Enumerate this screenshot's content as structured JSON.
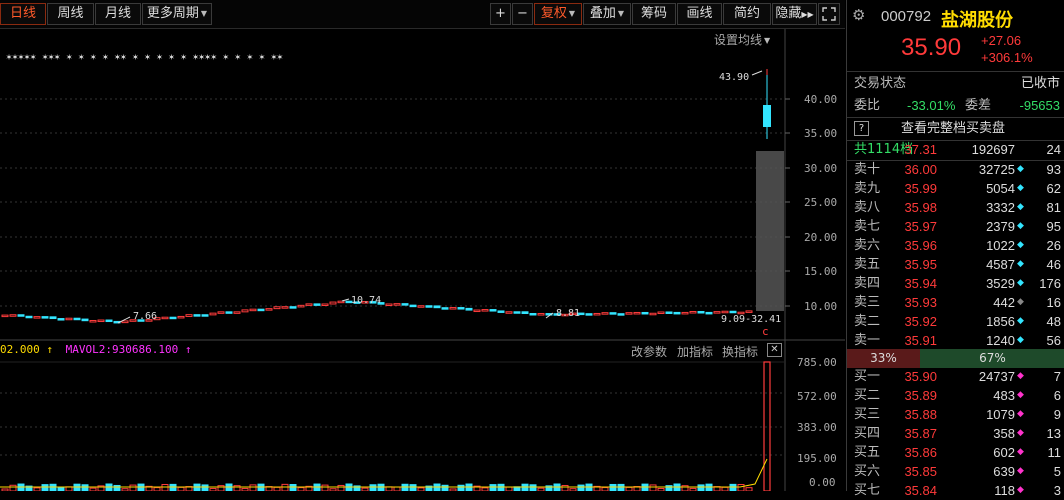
{
  "toolbar": {
    "tabs": [
      "日线",
      "周线",
      "月线",
      "更多周期"
    ],
    "plus": "+",
    "minus": "−",
    "fuquan": "复权",
    "diejia": "叠加",
    "chouma": "筹码",
    "huaxian": "画线",
    "jianyue": "简约",
    "yincang": "隐藏",
    "expand_icon": "expand-icon",
    "more_icon": "double-arrow-right-icon"
  },
  "chart": {
    "set_ma_label": "设置均线",
    "star_marks": "✶✶✶✶✶   ✶✶✶   ✶     ✶      ✶   ✶    ✶✶      ✶   ✶              ✶               ✶     ✶       ✶✶✶✶   ✶   ✶      ✶   ✶      ✶✶",
    "price_axis": [
      "40.00",
      "35.00",
      "30.00",
      "25.00",
      "20.00",
      "15.00",
      "10.00"
    ],
    "high_label": "43.90",
    "low_label": "7.66",
    "peak_label": "10.74",
    "mid_label": "8.81",
    "end_label": "9.09-32.41",
    "signal_icon": "c-signal-icon",
    "volume_axis": [
      "785.00",
      "572.00",
      "383.00",
      "195.00",
      "0.00"
    ],
    "vol_legend_1": "02.000",
    "vol_legend_2": "MAVOL2:930686.100",
    "ind_btn_1": "改参数",
    "ind_btn_2": "加指标",
    "ind_btn_3": "换指标",
    "close_icon": "close-icon",
    "colors": {
      "up": "#ff3c3c",
      "down": "#33e5ff",
      "ma": "#ffffff",
      "mavol": "#ff33ff"
    }
  },
  "panel": {
    "code": "000792",
    "name": "盐湖股份",
    "price": "35.90",
    "change": "+27.06",
    "change_pct": "+306.1%",
    "trade_status_label": "交易状态",
    "trade_status_value": "已收市",
    "weibi_label": "委比",
    "weibi_value": "-33.01%",
    "weicha_label": "委差",
    "weicha_value": "-95653",
    "help_icon": "help-icon",
    "full_book_label": "查看完整档买卖盘",
    "total_label": "共1114档",
    "total_price": "37.31",
    "total_vol": "192697",
    "total_cnt": "24",
    "ratio_left": "33%",
    "ratio_right": "67%",
    "asks": [
      {
        "label": "卖十",
        "price": "36.00",
        "vol": "32725",
        "cnt": "93",
        "dot": "#33e5ff"
      },
      {
        "label": "卖九",
        "price": "35.99",
        "vol": "5054",
        "cnt": "62",
        "dot": "#33e5ff"
      },
      {
        "label": "卖八",
        "price": "35.98",
        "vol": "3332",
        "cnt": "81",
        "dot": "#33e5ff"
      },
      {
        "label": "卖七",
        "price": "35.97",
        "vol": "2379",
        "cnt": "95",
        "dot": "#33e5ff"
      },
      {
        "label": "卖六",
        "price": "35.96",
        "vol": "1022",
        "cnt": "26",
        "dot": "#33e5ff"
      },
      {
        "label": "卖五",
        "price": "35.95",
        "vol": "4587",
        "cnt": "46",
        "dot": "#33e5ff"
      },
      {
        "label": "卖四",
        "price": "35.94",
        "vol": "3529",
        "cnt": "176",
        "dot": "#33e5ff"
      },
      {
        "label": "卖三",
        "price": "35.93",
        "vol": "442",
        "cnt": "16",
        "dot": "#888888"
      },
      {
        "label": "卖二",
        "price": "35.92",
        "vol": "1856",
        "cnt": "48",
        "dot": "#33e5ff"
      },
      {
        "label": "卖一",
        "price": "35.91",
        "vol": "1240",
        "cnt": "56",
        "dot": "#33e5ff"
      }
    ],
    "bids": [
      {
        "label": "买一",
        "price": "35.90",
        "vol": "24737",
        "cnt": "7",
        "dot": "#ff33cc"
      },
      {
        "label": "买二",
        "price": "35.89",
        "vol": "483",
        "cnt": "6",
        "dot": "#ff33cc"
      },
      {
        "label": "买三",
        "price": "35.88",
        "vol": "1079",
        "cnt": "9",
        "dot": "#ff33cc"
      },
      {
        "label": "买四",
        "price": "35.87",
        "vol": "358",
        "cnt": "13",
        "dot": "#ff33cc"
      },
      {
        "label": "买五",
        "price": "35.86",
        "vol": "602",
        "cnt": "11",
        "dot": "#ff33cc"
      },
      {
        "label": "买六",
        "price": "35.85",
        "vol": "639",
        "cnt": "5",
        "dot": "#ff33cc"
      },
      {
        "label": "买七",
        "price": "35.84",
        "vol": "118",
        "cnt": "3",
        "dot": "#ff33cc"
      }
    ]
  }
}
